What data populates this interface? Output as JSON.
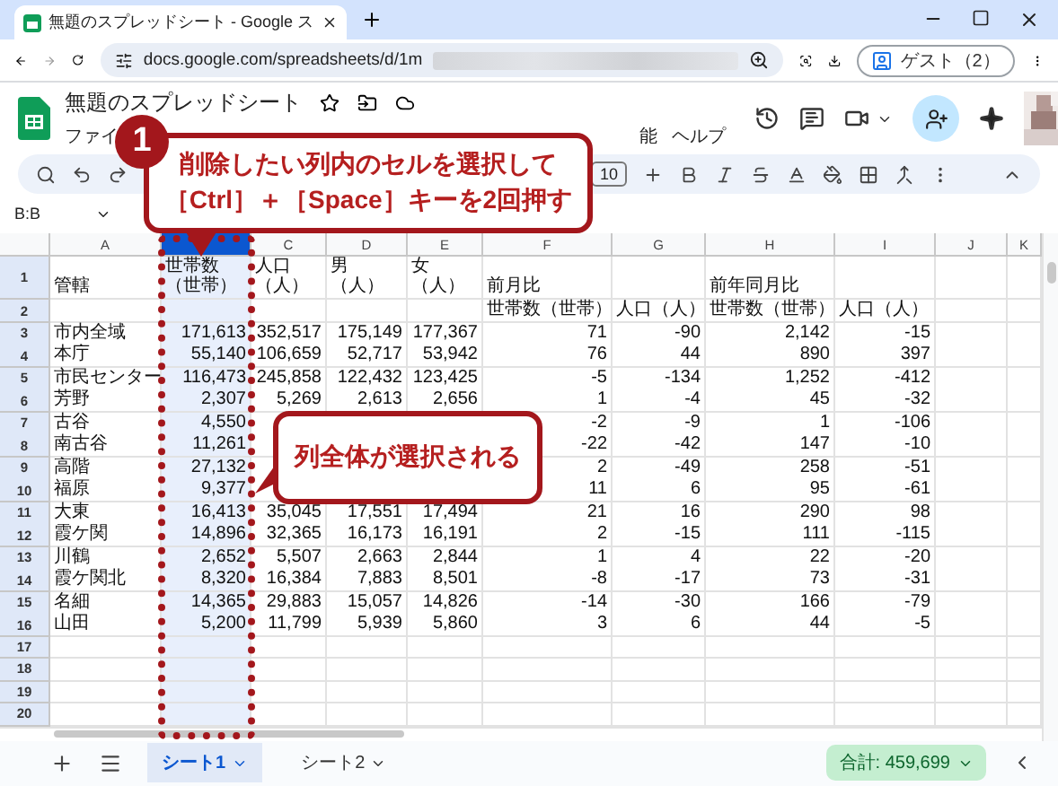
{
  "browser": {
    "tab_title": "無題のスプレッドシート - Google ス",
    "url": "docs.google.com/spreadsheets/d/1m",
    "profile": "ゲスト（2）"
  },
  "app": {
    "title": "無題のスプレッドシート",
    "menu": [
      "ファイ",
      "能",
      "ヘルプ"
    ],
    "font_size": "10",
    "name_box": "B:B"
  },
  "callouts": [
    {
      "badge": "1",
      "lines": [
        "削除したい列内のセルを選択して",
        "［Ctrl］＋［Space］キーを2回押す"
      ]
    },
    {
      "lines": [
        "列全体が選択される"
      ]
    }
  ],
  "columns": [
    {
      "label": "A",
      "selected": false
    },
    {
      "selected": true
    },
    {
      "label": "C",
      "selected": false
    },
    {
      "label": "D",
      "selected": false
    },
    {
      "label": "E",
      "selected": false
    },
    {
      "label": "F",
      "selected": false
    },
    {
      "label": "G",
      "selected": false
    },
    {
      "label": "H",
      "selected": false
    },
    {
      "label": "I",
      "selected": false
    },
    {
      "label": "J",
      "selected": false
    },
    {
      "label": "K",
      "selected": false
    }
  ],
  "rows": [
    {
      "number": "1",
      "kind": "header",
      "cells": [
        "管轄",
        [
          "世帯数",
          "（世帯）"
        ],
        [
          "人口",
          "（人）"
        ],
        [
          "男",
          "（人）"
        ],
        [
          "女",
          "（人）"
        ],
        "前月比",
        null,
        "前年同月比",
        null
      ]
    },
    {
      "number": "2",
      "kind": "header",
      "cells": [
        null,
        null,
        null,
        null,
        null,
        "世帯数（世帯）",
        "人口（人）",
        "世帯数（世帯）",
        "人口（人）"
      ]
    },
    {
      "number": "3",
      "kind": "data",
      "cells": [
        "市内全域",
        "171,613",
        "352,517",
        "175,149",
        "177,367",
        "71",
        "-90",
        "2,142",
        "-15"
      ]
    },
    {
      "number": "4",
      "kind": "data",
      "cells": [
        "本庁",
        "55,140",
        "106,659",
        "52,717",
        "53,942",
        "76",
        "44",
        "890",
        "397"
      ]
    },
    {
      "number": "5",
      "kind": "data",
      "cells": [
        "市民センター",
        "116,473",
        "245,858",
        "122,432",
        "123,425",
        "-5",
        "-134",
        "1,252",
        "-412"
      ]
    },
    {
      "number": "6",
      "kind": "data",
      "cells": [
        "芳野",
        "2,307",
        "5,269",
        "2,613",
        "2,656",
        "1",
        "-4",
        "45",
        "-32"
      ]
    },
    {
      "number": "7",
      "kind": "data",
      "cells": [
        "古谷",
        "4,550",
        null,
        null,
        null,
        "-2",
        "-9",
        "1",
        "-106"
      ]
    },
    {
      "number": "8",
      "kind": "data",
      "cells": [
        "南古谷",
        "11,261",
        null,
        null,
        null,
        "-22",
        "-42",
        "147",
        "-10"
      ]
    },
    {
      "number": "9",
      "kind": "data",
      "cells": [
        "高階",
        "27,132",
        null,
        null,
        null,
        "2",
        "-49",
        "258",
        "-51"
      ]
    },
    {
      "number": "10",
      "kind": "data",
      "cells": [
        "福原",
        "9,377",
        null,
        null,
        null,
        "11",
        "6",
        "95",
        "-61"
      ]
    },
    {
      "number": "11",
      "kind": "data",
      "cells": [
        "大東",
        "16,413",
        "35,045",
        "17,551",
        "17,494",
        "21",
        "16",
        "290",
        "98"
      ]
    },
    {
      "number": "12",
      "kind": "data",
      "cells": [
        "霞ケ関",
        "14,896",
        "32,365",
        "16,173",
        "16,191",
        "2",
        "-15",
        "111",
        "-115"
      ]
    },
    {
      "number": "13",
      "kind": "data",
      "cells": [
        "川鶴",
        "2,652",
        "5,507",
        "2,663",
        "2,844",
        "1",
        "4",
        "22",
        "-20"
      ]
    },
    {
      "number": "14",
      "kind": "data",
      "cells": [
        "霞ケ関北",
        "8,320",
        "16,384",
        "7,883",
        "8,501",
        "-8",
        "-17",
        "73",
        "-31"
      ]
    },
    {
      "number": "15",
      "kind": "data",
      "cells": [
        "名細",
        "14,365",
        "29,883",
        "15,057",
        "14,826",
        "-14",
        "-30",
        "166",
        "-79"
      ]
    },
    {
      "number": "16",
      "kind": "data",
      "cells": [
        "山田",
        "5,200",
        "11,799",
        "5,939",
        "5,860",
        "3",
        "6",
        "44",
        "-5"
      ]
    },
    {
      "number": "17",
      "kind": "data",
      "cells": []
    },
    {
      "number": "18",
      "kind": "data",
      "cells": []
    },
    {
      "number": "19",
      "kind": "data",
      "cells": []
    },
    {
      "number": "20",
      "kind": "data",
      "cells": []
    }
  ],
  "sheets": [
    {
      "label": "シート1",
      "selected": true
    },
    {
      "label": "シート2",
      "selected": false
    }
  ],
  "sum": "合計: 459,699"
}
